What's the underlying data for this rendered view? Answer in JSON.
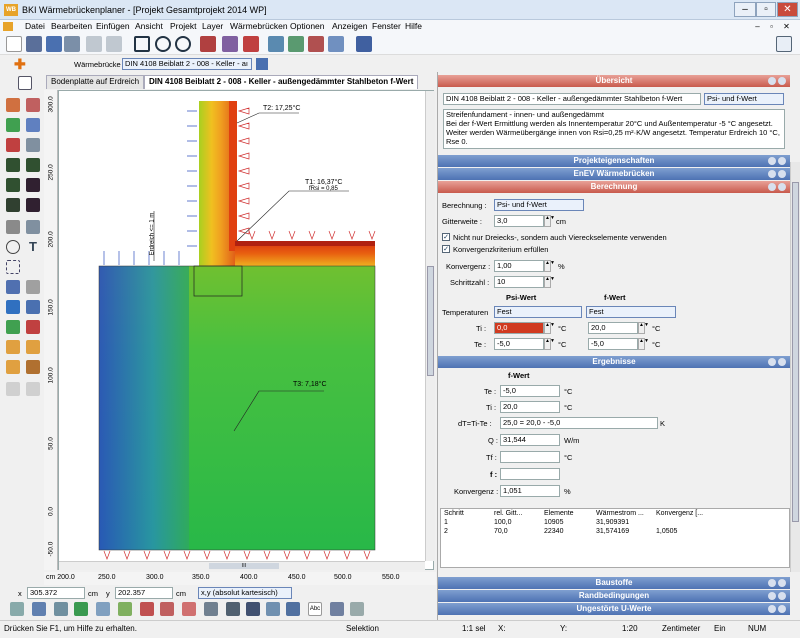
{
  "window": {
    "title": "BKI Wärmebrückenplaner - [Projekt Gesamtprojekt 2014 WP]",
    "app_icon": "WB"
  },
  "menu": [
    "Datei",
    "Bearbeiten",
    "Einfügen",
    "Ansicht",
    "Projekt",
    "Layer",
    "Wärmebrücken",
    "Optionen",
    "Anzeigen",
    "Fenster",
    "Hilfe"
  ],
  "secondbar": {
    "label": "Wärmebrücke :",
    "value": "DIN 4108 Beiblatt 2 - 008 - Keller - aı"
  },
  "tabs": [
    "Bodenplatte auf Erdreich",
    "DIN 4108 Beiblatt 2 - 008 - Keller - außengedämmter Stahlbeton f-Wert"
  ],
  "drawing": {
    "annotations": [
      "T2: 17,25°C",
      "T1: 16,37°C",
      "fRsi = 0,85",
      "T3: 7,18°C",
      "Erdreich <= 1 m"
    ],
    "vruler": [
      "cm",
      "300.0",
      "250.0",
      "200.0",
      "150.0",
      "100.0",
      "50.0",
      "0.0",
      "-50.0"
    ],
    "hruler": [
      "cm 200.0",
      "250.0",
      "300.0",
      "350.0",
      "400.0",
      "450.0",
      "500.0",
      "550.0"
    ],
    "scrollbar_label": "III"
  },
  "coords": {
    "x_label": "x",
    "x_value": "305.372",
    "x_unit": "cm",
    "y_label": "y",
    "y_value": "202.357",
    "y_unit": "cm",
    "system": "x,y (absolut kartesisch)"
  },
  "panel": {
    "overview_header": "Übersicht",
    "name": "DIN 4108 Beiblatt 2 - 008 - Keller - außengedämmter Stahlbeton f-Wert",
    "type": "Psi- und f-Wert",
    "description": "Streifenfundament - innen- und außengedämmt\nBei der f-Wert Ermittlung werden als Innentemperatur 20°C und Außentemperatur -5 °C angesetzt. Weiter werden Wärmeübergänge innen von Rsi=0,25 m²·K/W angesetzt. Temperatur Erdreich 10 °C, Rse 0.",
    "projekt_header": "Projekteigenschaften",
    "enev_header": "EnEV Wärmebrücken",
    "berechnung_header": "Berechnung",
    "berechnung_label": "Berechnung :",
    "berechnung_value": "Psi- und f-Wert",
    "gitter_label": "Gitterweite :",
    "gitter_value": "3,0",
    "gitter_unit": "cm",
    "chk1": "Nicht nur Dreiecks-, sondern auch Viereckselemente verwenden",
    "chk2": "Konvergenzkriterium erfüllen",
    "konv_label": "Konvergenz :",
    "konv_value": "1,00",
    "konv_unit": "%",
    "schritt_label": "Schrittzahl :",
    "schritt_value": "10",
    "psi_head": "Psi-Wert",
    "f_head": "f-Wert",
    "temp_label": "Temperaturen",
    "temp_psi": "Fest",
    "temp_f": "Fest",
    "ti_label": "Ti :",
    "ti_psi": "0,0",
    "ti_f": "20,0",
    "te_label": "Te :",
    "te_psi": "-5,0",
    "te_f": "-5,0",
    "deg": "°C",
    "ergebnisse_header": "Ergebnisse",
    "res_head": "f-Wert",
    "res_te_label": "Te :",
    "res_te": "-5,0",
    "res_te_unit": "°C",
    "res_ti_label": "Ti :",
    "res_ti": "20,0",
    "res_ti_unit": "°C",
    "res_dt_label": "dT=Ti-Te :",
    "res_dt": "25,0 = 20,0 - -5,0",
    "res_dt_unit": "K",
    "res_q_label": "Q :",
    "res_q": "31,544",
    "res_q_unit": "W/m",
    "res_tf_label": "Tf :",
    "res_tf": "",
    "res_tf_unit": "°C",
    "res_f_label": "f :",
    "res_f": "",
    "res_k_label": "Konvergenz :",
    "res_k": "1,051",
    "res_k_unit": "%",
    "table_headers": [
      "Schritt",
      "rel. Gitt...",
      "Elemente",
      "Wärmestrom ...",
      "Konvergenz [..."
    ],
    "table_rows": [
      [
        "1",
        "100,0",
        "10905",
        "31,909391",
        ""
      ],
      [
        "2",
        "70,0",
        "22340",
        "31,574169",
        "1,0505"
      ]
    ],
    "baustoffe_header": "Baustoffe",
    "rand_header": "Randbedingungen",
    "ungestoert_header": "Ungestörte U-Werte"
  },
  "status": {
    "hint": "Drücken Sie F1, um Hilfe zu erhalten.",
    "mode": "Selektion",
    "scale": "1:1 sel",
    "x": "X:",
    "y": "Y:",
    "ratio": "1:20",
    "unit": "Zentimeter",
    "ein": "Ein",
    "num": "NUM"
  },
  "colors": {
    "hot": "#d2281a",
    "warm": "#f0a020",
    "mid": "#c8d820",
    "cool": "#28b848",
    "cold": "#2848c8",
    "header": "#5577b6",
    "active_header": "#c85a4d"
  }
}
